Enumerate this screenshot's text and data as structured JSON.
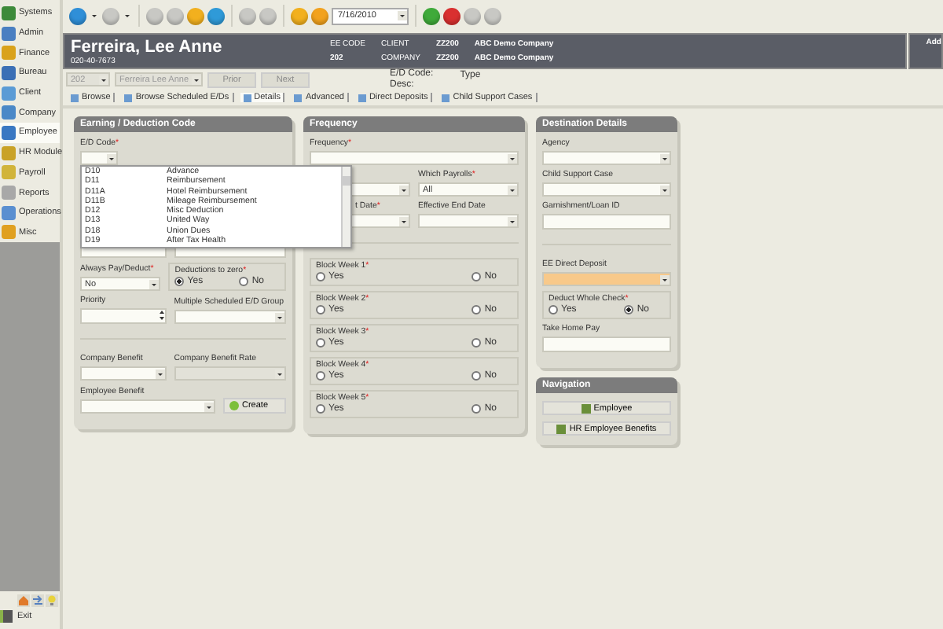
{
  "sidebar": {
    "items": [
      {
        "label": "Systems",
        "selected": false,
        "color": "#3d8a3a"
      },
      {
        "label": "Admin",
        "selected": false,
        "color": "#4a7fc1"
      },
      {
        "label": "Finance",
        "selected": false,
        "color": "#d9a21b"
      },
      {
        "label": "Bureau",
        "selected": false,
        "color": "#3b6fb5"
      },
      {
        "label": "Client",
        "selected": false,
        "color": "#5b9bd5"
      },
      {
        "label": "Company",
        "selected": false,
        "color": "#4a88c7"
      },
      {
        "label": "Employee",
        "selected": true,
        "color": "#3a78c2"
      },
      {
        "label": "HR Module",
        "selected": false,
        "color": "#c9a227"
      },
      {
        "label": "Payroll",
        "selected": false,
        "color": "#d1b43a"
      },
      {
        "label": "Reports",
        "selected": false,
        "color": "#a8a8a8"
      },
      {
        "label": "Operations",
        "selected": false,
        "color": "#5a8fd0"
      },
      {
        "label": "Misc",
        "selected": false,
        "color": "#e0a020"
      }
    ],
    "exit": "Exit"
  },
  "toolbar": {
    "date": "7/16/2010"
  },
  "header": {
    "name": "Ferreira, Lee Anne",
    "ssn": "020-40-7673",
    "ee_code_label": "EE CODE",
    "ee_code": "202",
    "client_label": "CLIENT",
    "client": "ZZ200",
    "company_label": "COMPANY",
    "company": "ZZ200",
    "client_name": "ABC Demo Company",
    "company_name": "ABC Demo Company",
    "side_label": "Add"
  },
  "record_bar": {
    "code": "202",
    "employee": "Ferreira Lee Anne",
    "prior": "Prior",
    "next": "Next",
    "ed_code_label": "E/D Code:",
    "desc_label": "Desc:",
    "type_label": "Type"
  },
  "tabs": [
    {
      "label": "Browse",
      "selected": false
    },
    {
      "label": "Browse Scheduled E/Ds",
      "selected": false
    },
    {
      "label": "Details",
      "selected": true
    },
    {
      "label": "Advanced",
      "selected": false
    },
    {
      "label": "Direct Deposits",
      "selected": false
    },
    {
      "label": "Child Support Cases",
      "selected": false
    }
  ],
  "panels": [
    {
      "title": "Earning / Deduction Code",
      "rows": [
        {
          "kind": "fields",
          "fields": [
            {
              "kind": "select",
              "label": "E/D Code",
              "required_mark": "*"
            }
          ]
        },
        {
          "kind": "hidden",
          "fields": [
            {
              "kind": "input"
            },
            {
              "kind": "input"
            }
          ]
        },
        {
          "kind": "fields",
          "fields": [
            {
              "kind": "select",
              "label": "Always Pay/Deduct",
              "required_mark": "*",
              "value": "No"
            },
            {
              "kind": "radio",
              "label": "Deductions to zero",
              "required_mark": "*",
              "options": [
                {
                  "label": "Yes",
                  "selected": true
                },
                {
                  "label": "No",
                  "selected": false
                }
              ]
            }
          ]
        },
        {
          "kind": "fields",
          "fields": [
            {
              "kind": "spin",
              "label": "Priority"
            },
            {
              "kind": "select",
              "label": "Multiple Scheduled E/D Group"
            }
          ]
        },
        {
          "kind": "divider"
        },
        {
          "kind": "fields",
          "fields": [
            {
              "kind": "select",
              "label": "Company Benefit"
            },
            {
              "kind": "select",
              "label": "Company Benefit Rate",
              "disabled": true
            }
          ]
        },
        {
          "kind": "fields",
          "fields": [
            {
              "kind": "select",
              "label": "Employee Benefit"
            },
            {
              "kind": "button",
              "label": "Create"
            }
          ]
        }
      ]
    },
    {
      "title": "Frequency",
      "rows": [
        {
          "kind": "fields",
          "fields": [
            {
              "kind": "select",
              "label": "Frequency",
              "required_mark": "*"
            }
          ]
        },
        {
          "kind": "fields",
          "fields": [
            {
              "kind": "select"
            },
            {
              "kind": "select",
              "label": "Which Payrolls",
              "required_mark": "*",
              "value": "All"
            }
          ]
        },
        {
          "kind": "fields",
          "fields": [
            {
              "kind": "select",
              "label": "t Date",
              "required_mark": "*"
            },
            {
              "kind": "select",
              "label": "Effective End Date"
            }
          ]
        },
        {
          "kind": "divider"
        },
        {
          "kind": "fields",
          "fields": [
            {
              "kind": "radio",
              "label": "Block Week 1",
              "required_mark": "*",
              "options": [
                {
                  "label": "Yes",
                  "selected": false
                },
                {
                  "label": "No",
                  "selected": false
                }
              ]
            }
          ]
        },
        {
          "kind": "fields",
          "fields": [
            {
              "kind": "radio",
              "label": "Block Week 2",
              "required_mark": "*",
              "options": [
                {
                  "label": "Yes",
                  "selected": false
                },
                {
                  "label": "No",
                  "selected": false
                }
              ]
            }
          ]
        },
        {
          "kind": "fields",
          "fields": [
            {
              "kind": "radio",
              "label": "Block Week 3",
              "required_mark": "*",
              "options": [
                {
                  "label": "Yes",
                  "selected": false
                },
                {
                  "label": "No",
                  "selected": false
                }
              ]
            }
          ]
        },
        {
          "kind": "fields",
          "fields": [
            {
              "kind": "radio",
              "label": "Block Week 4",
              "required_mark": "*",
              "options": [
                {
                  "label": "Yes",
                  "selected": false
                },
                {
                  "label": "No",
                  "selected": false
                }
              ]
            }
          ]
        },
        {
          "kind": "fields",
          "fields": [
            {
              "kind": "radio",
              "label": "Block Week 5",
              "required_mark": "*",
              "options": [
                {
                  "label": "Yes",
                  "selected": false
                },
                {
                  "label": "No",
                  "selected": false
                }
              ]
            }
          ]
        }
      ]
    },
    {
      "title": "Destination Details",
      "rows": [
        {
          "kind": "fields",
          "fields": [
            {
              "kind": "select",
              "label": "Agency"
            }
          ]
        },
        {
          "kind": "fields",
          "fields": [
            {
              "kind": "select",
              "label": "Child Support Case"
            }
          ]
        },
        {
          "kind": "fields",
          "fields": [
            {
              "kind": "input",
              "label": "Garnishment/Loan ID"
            }
          ]
        },
        {
          "kind": "divider"
        },
        {
          "kind": "fields",
          "fields": [
            {
              "kind": "select",
              "label": "EE Direct Deposit",
              "highlighted": true
            }
          ]
        },
        {
          "kind": "fields",
          "fields": [
            {
              "kind": "radio",
              "label": "Deduct Whole Check",
              "required_mark": "*",
              "options": [
                {
                  "label": "Yes",
                  "selected": false
                },
                {
                  "label": "No",
                  "selected": true
                }
              ]
            }
          ]
        },
        {
          "kind": "fields",
          "fields": [
            {
              "kind": "input",
              "label": "Take Home Pay"
            }
          ]
        }
      ]
    }
  ],
  "navigation": {
    "title": "Navigation",
    "buttons": [
      "Employee",
      "HR Employee Benefits"
    ]
  },
  "ed_code_dropdown": {
    "options": [
      {
        "code": "D10",
        "description": "Advance"
      },
      {
        "code": "D11",
        "description": "Reimbursement"
      },
      {
        "code": "D11A",
        "description": "Hotel Reimbursement"
      },
      {
        "code": "D11B",
        "description": "Mileage Reimbursement"
      },
      {
        "code": "D12",
        "description": "Misc Deduction"
      },
      {
        "code": "D13",
        "description": "United Way"
      },
      {
        "code": "D18",
        "description": "Union Dues"
      },
      {
        "code": "D19",
        "description": "After Tax Health"
      }
    ]
  }
}
